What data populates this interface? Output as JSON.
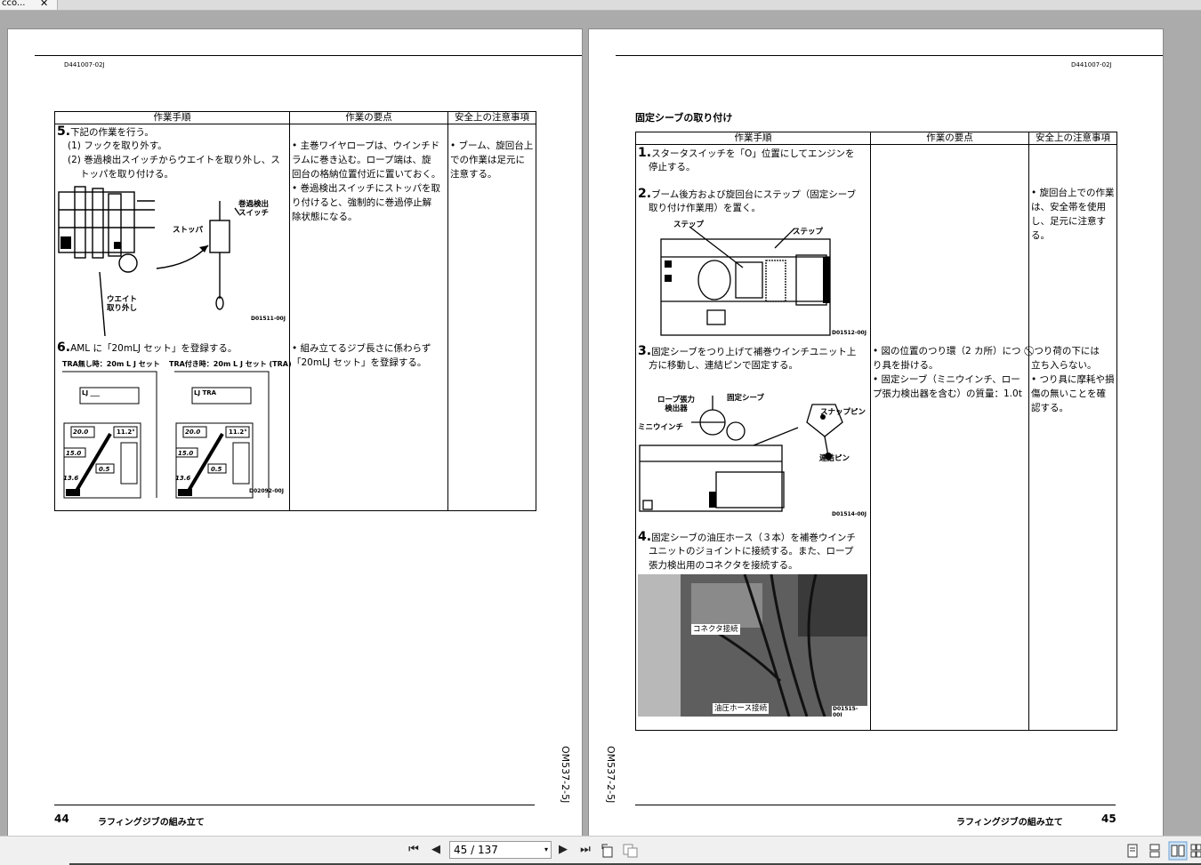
{
  "tab": {
    "title": "cco...",
    "close": "✕"
  },
  "left_page": {
    "doc_id": "D441007-02J",
    "headers": [
      "作業手順",
      "作業の要点",
      "安全上の注意事項"
    ],
    "step5": {
      "num": "5.",
      "text": "下記の作業を行う。",
      "sub1": "(1) フックを取り外す。",
      "sub2a": "(2) 巻過検出スイッチからウエイトを取り外し、ス",
      "sub2b": "トッパを取り付ける。"
    },
    "fig1": {
      "label_switch_a": "巻過検出",
      "label_switch_b": "スイッチ",
      "label_stopper": "ストッパ",
      "label_weight_a": "ウエイト",
      "label_weight_b": "取り外し",
      "code": "D01511-00J"
    },
    "points5": [
      "• 主巻ワイヤロープは、ウインチド",
      "ラムに巻き込む。ロープ端は、旋",
      "回台の格納位置付近に置いておく。",
      "• 巻過検出スイッチにストッパを取",
      "り付けると、強制的に巻過停止解",
      "除状態になる。"
    ],
    "safety5": [
      "• ブーム、旋回台上",
      "での作業は足元に",
      "注意する。"
    ],
    "step6": {
      "num": "6.",
      "text": "AML に「20mLJ セット」を登録する。",
      "cap_a": "TRA無し時：20m L J セット",
      "cap_b": "TRA付き時：20m L J セット (TRA)"
    },
    "fig2": {
      "lcd_a": "LJ ___",
      "lcd_b": "LJ TRA",
      "angle": "11.2°",
      "boom": "20.0",
      "radius": "15.0",
      "load": "0.5",
      "ratio": "13.6",
      "code": "D02092-00J"
    },
    "points6": [
      "• 組み立てるジブ長さに係わらず",
      "「20mLJ セット」を登録する。"
    ],
    "side_code": "OM537-2-5J",
    "page_number": "44",
    "footer_title": "ラフィングジブの組み立て"
  },
  "right_page": {
    "doc_id": "D441007-02J",
    "section_title": "固定シーブの取り付け",
    "headers": [
      "作業手順",
      "作業の要点",
      "安全上の注意事項"
    ],
    "step1": {
      "num": "1.",
      "l1": "スタータスイッチを「O」位置にしてエンジンを",
      "l2": "停止する。"
    },
    "step2": {
      "num": "2.",
      "l1": "ブーム後方および旋回台にステップ（固定シーブ",
      "l2": "取り付け作業用）を置く。"
    },
    "safety2": [
      "• 旋回台上での作業",
      "は、安全帯を使用",
      "し、足元に注意す",
      "る。"
    ],
    "fig3": {
      "label_a": "ステップ",
      "label_b": "ステップ",
      "code": "D01512-00J"
    },
    "step3": {
      "num": "3.",
      "l1": "固定シーブをつり上げて補巻ウインチユニット上",
      "l2": "方に移動し、連結ピンで固定する。"
    },
    "points3": [
      "• 図の位置のつり環（2 カ所）につ",
      "り具を掛ける。",
      "• 固定シーブ（ミニウインチ、ロー",
      "プ張力検出器を含む）の質量：1.0t"
    ],
    "safety3": [
      "⃠ つり荷の下には",
      "立ち入らない。",
      "• つり具に摩耗や損",
      "傷の無いことを確",
      "認する。"
    ],
    "fig4": {
      "label_rope_a": "ロープ張力",
      "label_rope_b": "検出器",
      "label_sheave": "固定シーブ",
      "label_mini": "ミニウインチ",
      "label_snap": "スナップピン",
      "label_pin": "連結ピン",
      "code": "D01514-00J"
    },
    "step4": {
      "num": "4.",
      "l1": "固定シーブの油圧ホース（３本）を補巻ウインチ",
      "l2": "ユニットのジョイントに接続する。また、ロープ",
      "l3": "張力検出用のコネクタを接続する。"
    },
    "photo": {
      "label_connector": "コネクタ接続",
      "label_hose": "油圧ホース接続",
      "code": "D01515-00J"
    },
    "side_code": "OM537-2-5J",
    "page_number": "45",
    "footer_title": "ラフィングジブの組み立て"
  },
  "toolbar": {
    "page_display": "45 / 137",
    "dropdown": "▾",
    "first": "⏮",
    "prev": "◀",
    "next": "▶",
    "last": "⏭"
  },
  "colors": {
    "viewer_bg": "#ababab",
    "page_bg": "#ffffff",
    "toolbar_bg": "#f0f0f0"
  }
}
